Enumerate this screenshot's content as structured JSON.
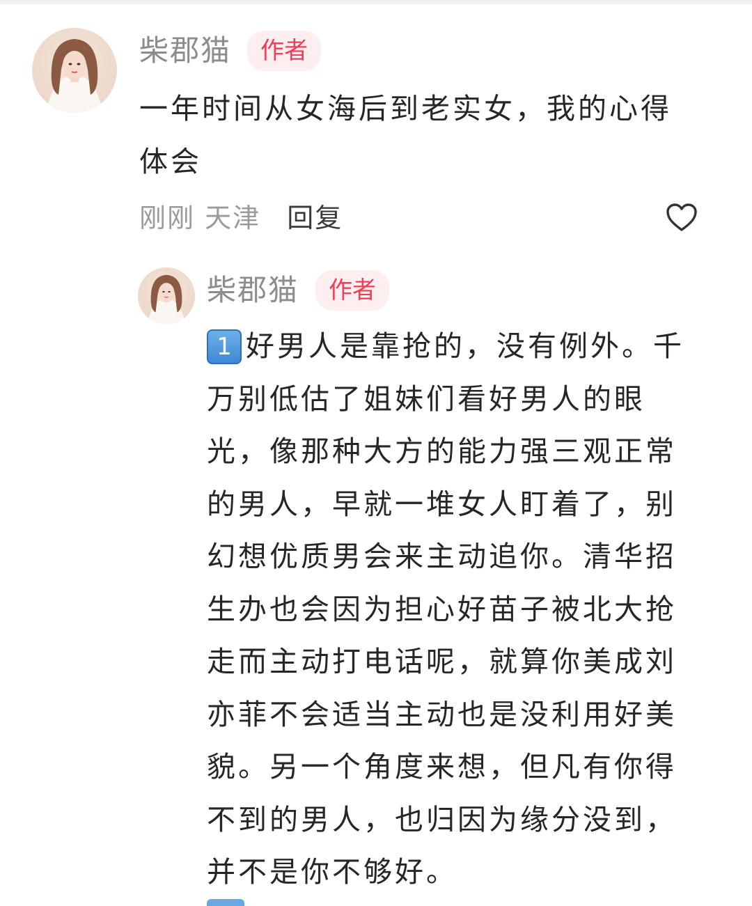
{
  "comment": {
    "author": "柴郡猫",
    "badge": "作者",
    "text_lines": [
      "一年时间从女海后到老实女，我的心得",
      "体会"
    ],
    "time": "刚刚",
    "location": "天津",
    "reply_label": "回复",
    "like_icon": "heart-outline-icon"
  },
  "reply": {
    "author": "柴郡猫",
    "badge": "作者",
    "emoji_number": "1",
    "emoji_icon": "keycap-1-icon",
    "text_lines": [
      "好男人是靠抢的，没有例外。千",
      "万别低估了姐妹们看好男人的眼",
      "光，像那种大方的能力强三观正常",
      "的男人，早就一堆女人盯着了，别",
      "幻想优质男会来主动追你。清华招",
      "生办也会因为担心好苗子被北大抢",
      "走而主动打电话呢，就算你美成刘",
      "亦菲不会适当主动也是没利用好美",
      "貌。另一个角度来想，但凡有你得",
      "不到的男人，也归因为缘分没到，",
      "并不是你不够好。"
    ]
  },
  "colors": {
    "badge_text": "#ef3e55",
    "badge_bg": "#fdeef0",
    "name": "#8c8c8c",
    "body": "#262626",
    "meta": "#9a9a9a"
  }
}
